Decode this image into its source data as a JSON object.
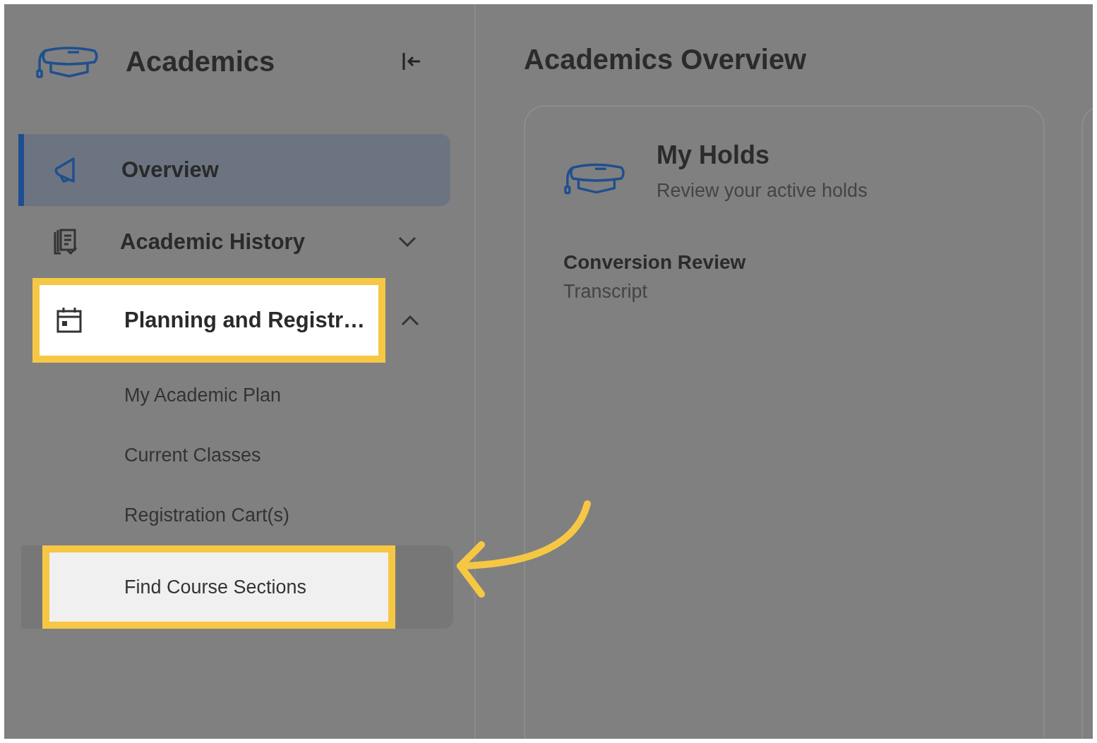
{
  "sidebar": {
    "title": "Academics",
    "items": [
      {
        "kind": "main",
        "label": "Overview",
        "selected": true,
        "highlighted": false
      },
      {
        "kind": "main",
        "label": "Academic History",
        "selected": false,
        "highlighted": false,
        "expanded": false
      },
      {
        "kind": "main",
        "label": "Planning and Registr…",
        "selected": false,
        "highlighted": true,
        "expanded": true,
        "children": [
          {
            "label": "My Academic Plan",
            "hovered": false,
            "highlighted": false
          },
          {
            "label": "Current Classes",
            "hovered": false,
            "highlighted": false
          },
          {
            "label": "Registration Cart(s)",
            "hovered": false,
            "highlighted": false
          },
          {
            "label": "Find Course Sections",
            "hovered": true,
            "highlighted": true
          }
        ]
      }
    ]
  },
  "main": {
    "title": "Academics Overview",
    "card": {
      "title": "My Holds",
      "subtitle": "Review your active holds",
      "holds": [
        {
          "name": "Conversion Review",
          "type": "Transcript"
        }
      ]
    }
  }
}
